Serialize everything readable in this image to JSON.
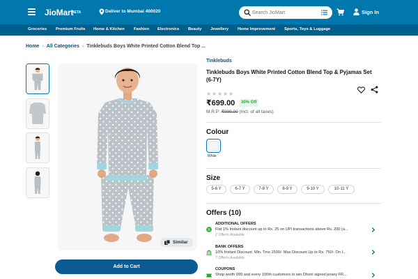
{
  "header": {
    "logo": "JioMart",
    "logo_badge": "BETA",
    "deliver_to": "Deliver to Mumbai 400020",
    "search_placeholder": "Search JioMart",
    "sign_in": "Sign In",
    "brand_color": "#0078ad"
  },
  "nav": {
    "items": [
      "Groceries",
      "Premium Fruits",
      "Home & Kitchen",
      "Fashion",
      "Electronics",
      "Beauty",
      "Jewellery",
      "Home Improvement",
      "Sports, Toys & Luggage"
    ]
  },
  "breadcrumb": {
    "home": "Home",
    "category": "All Categories",
    "current": "Tinklebuds Boys White Printed Cotton Blend Top ..."
  },
  "gallery": {
    "similar_label": "Similar",
    "active_thumb": 1
  },
  "actions": {
    "add_to_cart": "Add to Cart"
  },
  "product": {
    "brand": "Tinklebuds",
    "title": "Tinklebuds Boys White Printed Cotton Blend Top & Pyjamas Set (6-7Y)",
    "rating": 0,
    "rating_max": 5,
    "price": "₹699.00",
    "discount": "30% Off",
    "mrp_label": "M.R.P:",
    "mrp": "₹999.00",
    "tax_note": "(Incl. of all taxes)"
  },
  "colour": {
    "heading": "Colour",
    "selected": "White"
  },
  "size": {
    "heading": "Size",
    "options": [
      "5-6 Y",
      "6-7 Y",
      "7-8 Y",
      "8-9 Y",
      "9-10 Y",
      "10-11 Y"
    ]
  },
  "offers": {
    "heading": "Offers (10)",
    "items": [
      {
        "title": "ADDITIONAL OFFERS",
        "description": "Flat 1% Instant discount up to Rs. 25 on UPI transactions above Rs. 200 (a...",
        "count": "2 Offer/s Available",
        "icon": "percent-badge-icon"
      },
      {
        "title": "BANK OFFERS",
        "description": "10% Instant Discount. Min. Trnx 1500/- Max Discount Up to Rs. 750/- On I...",
        "count": "7 Offer/s Available",
        "icon": "bank-icon"
      },
      {
        "title": "COUPONS",
        "description": "Shop worth 999 and every 100th customers to win Dhoni signed jersey FR...",
        "count": "",
        "icon": "coupon-icon"
      }
    ]
  }
}
